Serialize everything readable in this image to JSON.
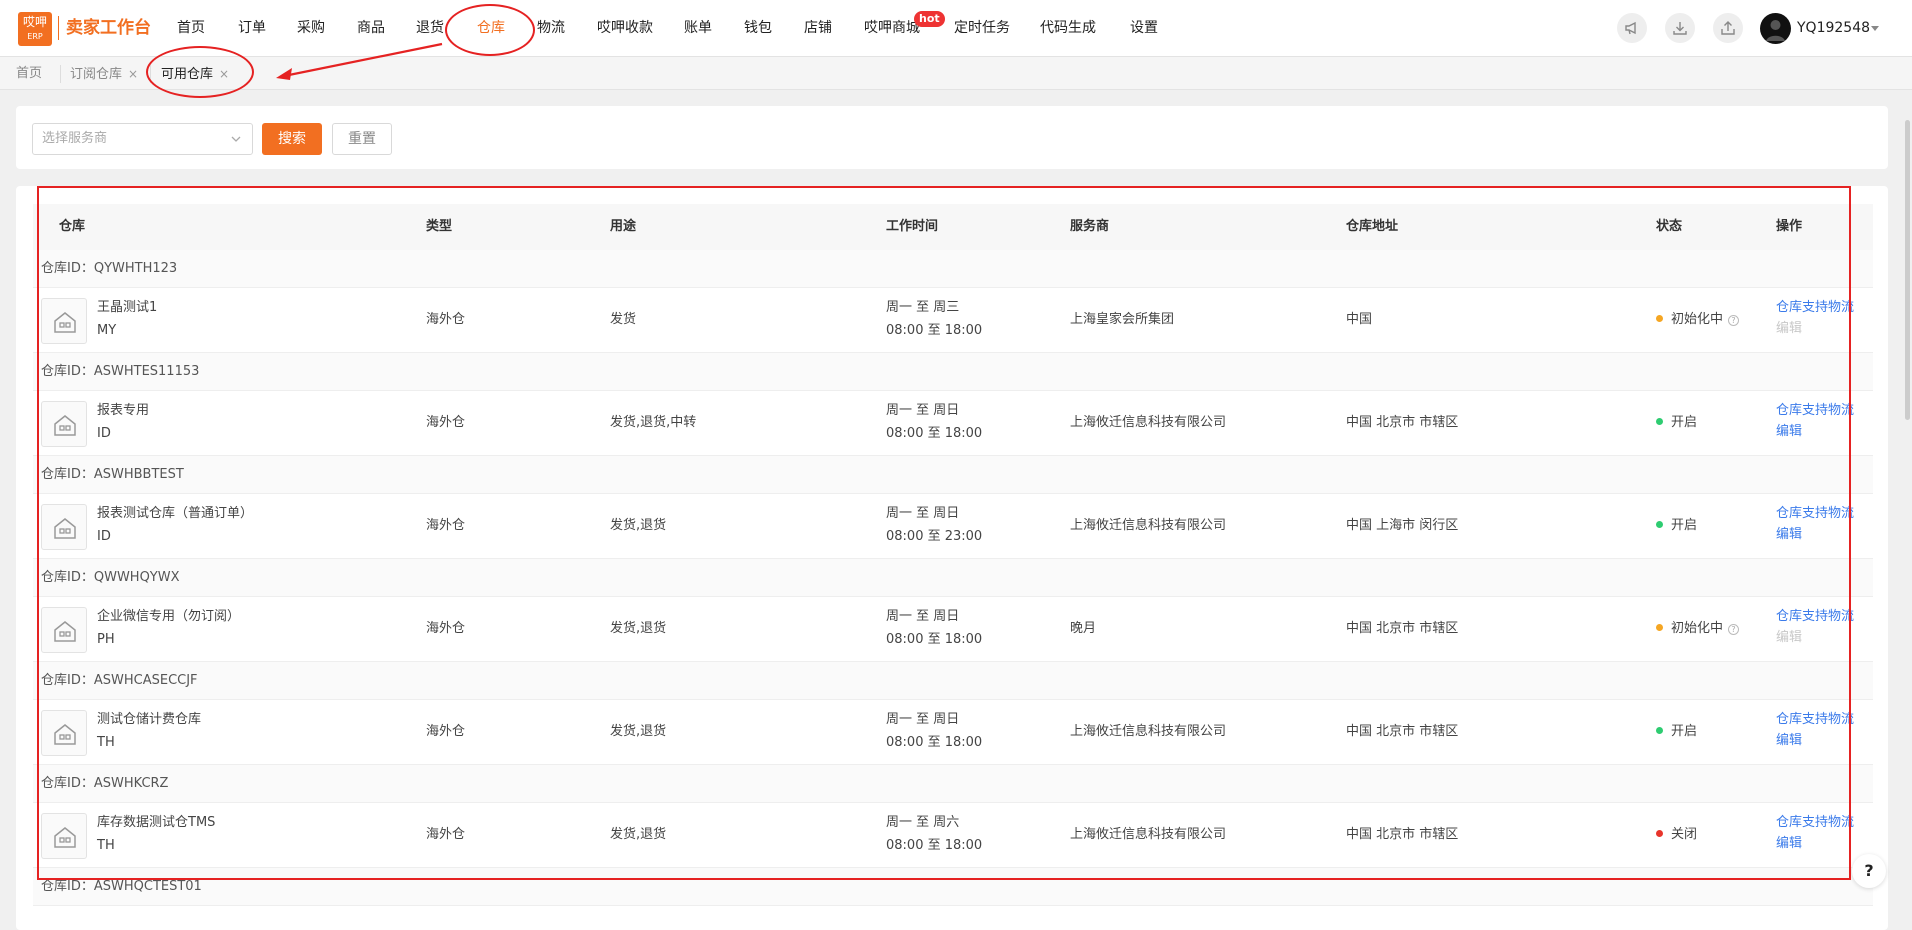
{
  "brand": {
    "logo_line1": "哎呷",
    "logo_line2": "ERP",
    "name": "卖家工作台"
  },
  "nav": [
    {
      "label": "首页"
    },
    {
      "label": "订单"
    },
    {
      "label": "采购"
    },
    {
      "label": "商品"
    },
    {
      "label": "退货"
    },
    {
      "label": "仓库"
    },
    {
      "label": "物流"
    },
    {
      "label": "哎呷收款"
    },
    {
      "label": "账单"
    },
    {
      "label": "钱包"
    },
    {
      "label": "店铺"
    },
    {
      "label": "哎呷商城"
    },
    {
      "label": "定时任务"
    },
    {
      "label": "代码生成"
    },
    {
      "label": "设置"
    }
  ],
  "nav_badge": "hot",
  "header_icons": [
    "megaphone-icon",
    "download-icon",
    "export-icon"
  ],
  "user": {
    "name": "YQ192548"
  },
  "tabs": [
    {
      "label": "首页",
      "closable": false
    },
    {
      "label": "订阅仓库",
      "closable": true
    },
    {
      "label": "可用仓库",
      "closable": true
    }
  ],
  "tab_close": "×",
  "filter": {
    "provider_placeholder": "选择服务商",
    "search_label": "搜索",
    "reset_label": "重置"
  },
  "table": {
    "columns": [
      "仓库",
      "类型",
      "用途",
      "工作时间",
      "服务商",
      "仓库地址",
      "状态",
      "操作"
    ],
    "id_prefix": "仓库ID：",
    "groups": [
      {
        "id": "QYWHTH123",
        "name": "王晶测试1",
        "code": "MY",
        "type": "海外仓",
        "usage": "发货",
        "days": "周一 至 周三",
        "hours": "08:00 至 18:00",
        "provider": "上海皇家会所集团",
        "address": "中国",
        "status": "初始化中",
        "status_color": "#f5a623",
        "status_help": true,
        "op1": "仓库支持物流",
        "op2": "编辑",
        "op2_disabled": true
      },
      {
        "id": "ASWHTES11153",
        "name": "报表专用",
        "code": "ID",
        "type": "海外仓",
        "usage": "发货,退货,中转",
        "days": "周一 至 周日",
        "hours": "08:00 至 18:00",
        "provider": "上海攸迁信息科技有限公司",
        "address": "中国 北京市 市辖区",
        "status": "开启",
        "status_color": "#2ecc71",
        "status_help": false,
        "op1": "仓库支持物流",
        "op2": "编辑",
        "op2_disabled": false
      },
      {
        "id": "ASWHBBTEST",
        "name": "报表测试仓库（普通订单）",
        "code": "ID",
        "type": "海外仓",
        "usage": "发货,退货",
        "days": "周一 至 周日",
        "hours": "08:00 至 23:00",
        "provider": "上海攸迁信息科技有限公司",
        "address": "中国 上海市 闵行区",
        "status": "开启",
        "status_color": "#2ecc71",
        "status_help": false,
        "op1": "仓库支持物流",
        "op2": "编辑",
        "op2_disabled": false
      },
      {
        "id": "QWWHQYWX",
        "name": "企业微信专用（勿订阅）",
        "code": "PH",
        "type": "海外仓",
        "usage": "发货,退货",
        "days": "周一 至 周日",
        "hours": "08:00 至 18:00",
        "provider": "晚月",
        "address": "中国 北京市 市辖区",
        "status": "初始化中",
        "status_color": "#f5a623",
        "status_help": true,
        "op1": "仓库支持物流",
        "op2": "编辑",
        "op2_disabled": true
      },
      {
        "id": "ASWHCASECCJF",
        "name": "测试仓储计费仓库",
        "code": "TH",
        "type": "海外仓",
        "usage": "发货,退货",
        "days": "周一 至 周日",
        "hours": "08:00 至 18:00",
        "provider": "上海攸迁信息科技有限公司",
        "address": "中国 北京市 市辖区",
        "status": "开启",
        "status_color": "#2ecc71",
        "status_help": false,
        "op1": "仓库支持物流",
        "op2": "编辑",
        "op2_disabled": false
      },
      {
        "id": "ASWHKCRZ",
        "name": "库存数据测试仓TMS",
        "code": "TH",
        "type": "海外仓",
        "usage": "发货,退货",
        "days": "周一 至 周六",
        "hours": "08:00 至 18:00",
        "provider": "上海攸迁信息科技有限公司",
        "address": "中国 北京市 市辖区",
        "status": "关闭",
        "status_color": "#e8342b",
        "status_help": false,
        "op1": "仓库支持物流",
        "op2": "编辑",
        "op2_disabled": false
      },
      {
        "id": "ASWHQCTEST01"
      }
    ]
  },
  "help_label": "?",
  "colors": {
    "accent": "#f26f21",
    "link": "#3b7bea",
    "annotation": "#e52222"
  }
}
